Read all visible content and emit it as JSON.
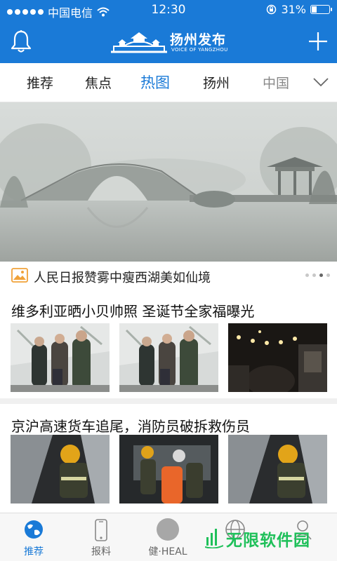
{
  "status_bar": {
    "carrier": "中国电信",
    "time": "12:30",
    "battery": "31%",
    "battery_level": 0.31
  },
  "header": {
    "logo_title": "扬州发布",
    "logo_subtitle": "VOICE OF YANGZHOU"
  },
  "tabs": [
    {
      "label": "推荐"
    },
    {
      "label": "焦点"
    },
    {
      "label": "热图"
    },
    {
      "label": "扬州"
    },
    {
      "label": "中国"
    }
  ],
  "active_tab": "热图",
  "hero": {
    "caption": "人民日报赞雾中瘦西湖美如仙境",
    "slide_count": 4,
    "active_slide": 3
  },
  "articles": [
    {
      "title": "维多利亚晒小贝帅照 圣诞节全家福曝光"
    },
    {
      "title": "京沪高速货车追尾，消防员破拆救伤员"
    }
  ],
  "bottom_nav": [
    {
      "label": "推荐",
      "icon": "globe-icon"
    },
    {
      "label": "报料",
      "icon": "phone-icon"
    },
    {
      "label": "健·HEAL",
      "icon": "circle-icon"
    },
    {
      "label": "",
      "icon": "world-icon"
    },
    {
      "label": "",
      "icon": "user-icon"
    }
  ],
  "watermark": {
    "text": "无限软件园"
  },
  "colors": {
    "brand_blue": "#1a7ad7",
    "watermark_green": "#1fc05a",
    "caption_icon": "#f0a23a"
  }
}
